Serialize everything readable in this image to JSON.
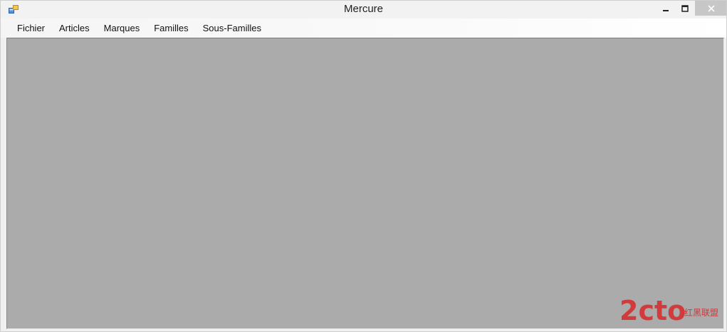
{
  "window": {
    "title": "Mercure",
    "minimize_glyph": "▁",
    "maximize_glyph": "▢",
    "close_glyph": "✕"
  },
  "menubar": {
    "items": [
      {
        "label": "Fichier"
      },
      {
        "label": "Articles"
      },
      {
        "label": "Marques"
      },
      {
        "label": "Familles"
      },
      {
        "label": "Sous-Familles"
      }
    ]
  },
  "watermark": {
    "logo_text": "2cto",
    "subtitle": "红黑联盟"
  },
  "colors": {
    "mdi_background": "#ababab",
    "watermark_red": "#c93a3a"
  },
  "icons": {
    "app": "app-window-icon"
  }
}
